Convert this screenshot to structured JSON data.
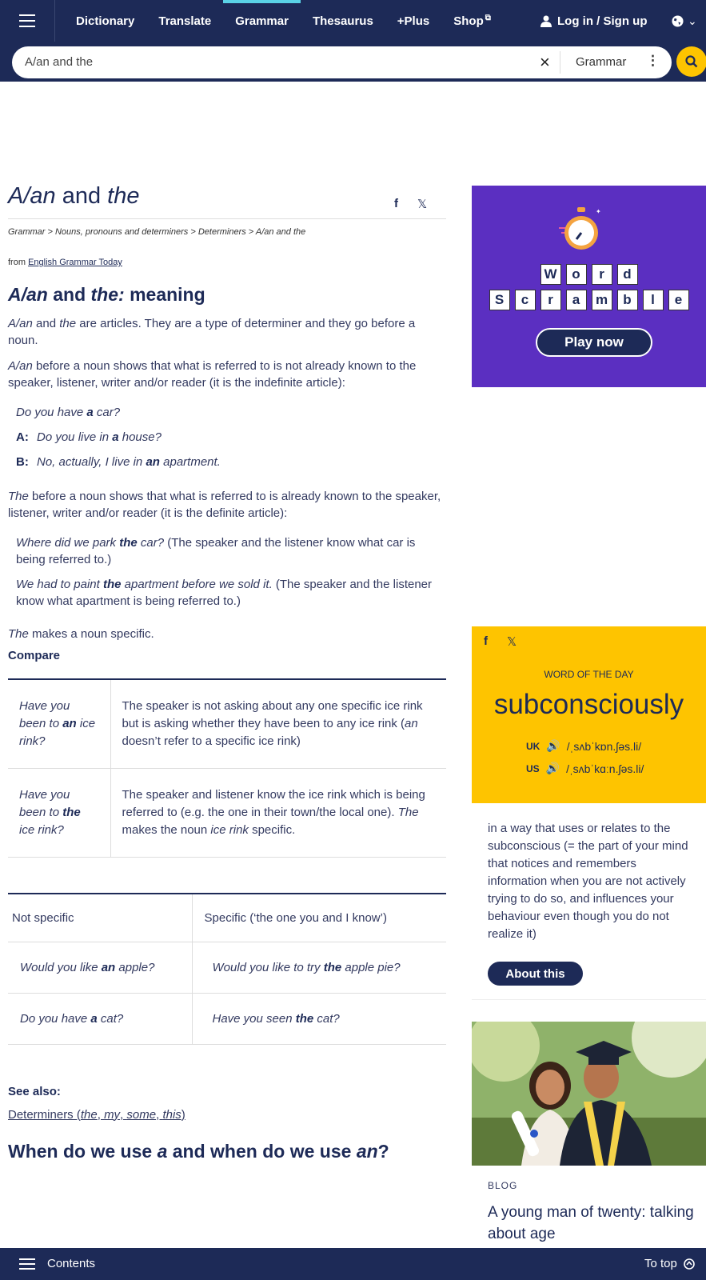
{
  "nav": {
    "items": [
      "Dictionary",
      "Translate",
      "Grammar",
      "Thesaurus",
      "+Plus",
      "Shop"
    ],
    "login": "Log in / Sign up"
  },
  "search": {
    "value": "A/an and the",
    "dictionary": "Grammar"
  },
  "page": {
    "title_a": "A/an",
    "title_b": " and ",
    "title_c": "the",
    "breadcrumb": "Grammar > Nouns, pronouns and determiners > Determiners > A/an and the",
    "from_prefix": "from ",
    "from_link": "English Grammar Today",
    "h_meaning_a": "A/an",
    "h_meaning_b": " and ",
    "h_meaning_c": "the:",
    "h_meaning_d": " meaning",
    "p1_a": "A/an",
    "p1_b": " and ",
    "p1_c": "the",
    "p1_d": " are articles. They are a type of determiner and they go before a noun.",
    "p2_a": "A/an",
    "p2_b": " before a noun shows that what is referred to is not already known to the speaker, listener, writer and/or reader (it is the indefinite article):",
    "ex1_a": "Do you have ",
    "ex1_b": "a",
    "ex1_c": " car?",
    "ex2_spk": "A:",
    "ex2_a": "Do you live in ",
    "ex2_b": "a",
    "ex2_c": " house?",
    "ex3_spk": "B:",
    "ex3_a": "No, actually, I live in ",
    "ex3_b": "an",
    "ex3_c": " apartment.",
    "p3_a": "The",
    "p3_b": " before a noun shows that what is referred to is already known to the speaker, listener, writer and/or reader (it is the definite article):",
    "ex4_a": "Where did we park ",
    "ex4_b": "the",
    "ex4_c": " car?",
    "ex4_d": " (The speaker and the listener know what car is being referred to.)",
    "ex5_a": "We had to paint ",
    "ex5_b": "the",
    "ex5_c": " apartment before we sold it.",
    "ex5_d": " (The speaker and the listener know what apartment is being referred to.)",
    "p4_a": "The",
    "p4_b": " makes a noun specific.",
    "compare": "Compare",
    "t1": [
      {
        "q_a": "Have you been to ",
        "q_b": "an",
        "q_c": " ice rink?",
        "e_a": "The speaker is not asking about any one specific ice rink but is asking whether they have been to any ice rink (",
        "e_b": "an",
        "e_c": " doesn’t refer to a specific ice rink)"
      },
      {
        "q_a": "Have you been to ",
        "q_b": "the",
        "q_c": " ice rink?",
        "e_a": "The speaker and listener know the ice rink which is being referred to (e.g. the one in their town/the local one). ",
        "e_b": "The",
        "e_c": " makes the noun ",
        "e_d": "ice rink",
        "e_e": " specific."
      }
    ],
    "t2": {
      "h1": "Not specific",
      "h2": "Specific (‘the one you and I know’)",
      "r1a_a": "Would you like ",
      "r1a_b": "an",
      "r1a_c": " apple?",
      "r1b_a": "Would you like to try ",
      "r1b_b": "the",
      "r1b_c": " apple pie?",
      "r2a_a": "Do you have ",
      "r2a_b": "a",
      "r2a_c": " cat?",
      "r2b_a": "Have you seen ",
      "r2b_b": "the",
      "r2b_c": " cat?"
    },
    "seealso": "See also:",
    "sa_a": "Determiners (",
    "sa_b": "the",
    "sa_c": ", ",
    "sa_d": "my",
    "sa_e": ", ",
    "sa_f": "some",
    "sa_g": ", ",
    "sa_h": "this",
    "sa_i": ")",
    "q_a": "When do we use ",
    "q_b": "a",
    "q_c": " and when do we use ",
    "q_d": "an",
    "q_e": "?"
  },
  "ad": {
    "row1": [
      "W",
      "o",
      "r",
      "d"
    ],
    "row2": [
      "S",
      "c",
      "r",
      "a",
      "m",
      "b",
      "l",
      "e"
    ],
    "play": "Play now",
    "color": "#5b2fc1"
  },
  "wotd": {
    "label": "WORD OF THE DAY",
    "word": "subconsciously",
    "uk": "UK",
    "uk_ipa": "/ˌsʌbˈkɒn.ʃəs.li/",
    "us": "US",
    "us_ipa": "/ˌsʌbˈkɑːn.ʃəs.li/",
    "definition": "in a way that uses or relates to the subconscious (= the part of your mind that notices and remembers information when you are not actively trying to do so, and influences your behaviour even though you do not realize it)",
    "about": "About this",
    "color": "#fec400"
  },
  "blog": {
    "label": "BLOG",
    "title": "A young man of twenty: talking about age"
  },
  "footer": {
    "contents": "Contents",
    "totop": "To top"
  }
}
